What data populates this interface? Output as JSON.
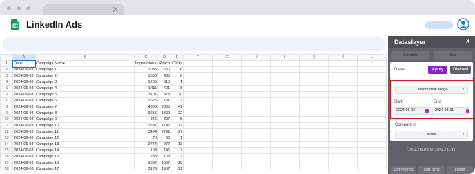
{
  "app": {
    "title": "LinkedIn Ads"
  },
  "sheet": {
    "columns": [
      "A",
      "B",
      "C",
      "D",
      "E",
      "F",
      "G",
      "H",
      "I",
      "J",
      "K",
      "L"
    ],
    "headers": [
      "Date",
      "Campaign Name",
      "Impressions",
      "Reach",
      "Clicks"
    ],
    "rows": [
      [
        "2024-06-03",
        "Campaign 1",
        "1036",
        "500",
        "6"
      ],
      [
        "2024-06-03",
        "Campaign 2",
        "1350",
        "435",
        "8"
      ],
      [
        "2024-06-03",
        "Campaign 3",
        "1235",
        "315",
        "1"
      ],
      [
        "2024-06-03",
        "Campaign 4",
        "1411",
        "401",
        "8"
      ],
      [
        "2024-06-03",
        "Campaign 5",
        "3107",
        "873",
        "20"
      ],
      [
        "2024-06-03",
        "Campaign 6",
        "2626",
        "151",
        "2"
      ],
      [
        "2024-06-03",
        "Campaign 7",
        "4835",
        "2835",
        "41"
      ],
      [
        "2024-06-03",
        "Campaign 8",
        "3256",
        "1809",
        "22"
      ],
      [
        "2024-06-03",
        "Campaign 9",
        "846",
        "397",
        "5"
      ],
      [
        "2024-06-03",
        "Campaign 10",
        "3581",
        "1142",
        "12"
      ],
      [
        "2024-06-03",
        "Campaign 11",
        "3494",
        "2291",
        "27"
      ],
      [
        "2024-06-03",
        "Campaign 12",
        "70",
        "63",
        "1"
      ],
      [
        "2024-06-03",
        "Campaign 13",
        "2744",
        "977",
        "13"
      ],
      [
        "2024-06-03",
        "Campaign 14",
        "193",
        "146",
        "7"
      ],
      [
        "2024-06-03",
        "Campaign 15",
        "233",
        "168",
        "2"
      ],
      [
        "2024-06-03",
        "Campaign 16",
        "1362",
        "1057",
        "20"
      ],
      [
        "2024-06-03",
        "Campaign 17",
        "3179",
        "1957",
        "21"
      ]
    ]
  },
  "panel": {
    "title": "Dataslayer",
    "close": "X",
    "tabs": [
      "Schedule",
      "Data"
    ],
    "dates_label": "Dates",
    "apply": "Apply",
    "discard": "Discard",
    "date_range_option": "Custom date range",
    "start_label": "Start",
    "end_label": "End",
    "start_value": "2024-06-03",
    "end_value": "2024-08-31",
    "compare_label": "Compare to",
    "compare_value": "None",
    "range_summary": "2024-06-03 to 2024-08-31",
    "footer_buttons": [
      "Sort metrics",
      "Sort dims",
      "Filters"
    ]
  },
  "colors": {
    "accent": "#8a1fd8",
    "highlight": "#e0121c",
    "panel": "#5f6368",
    "sheets_green": "#0f9d58"
  }
}
